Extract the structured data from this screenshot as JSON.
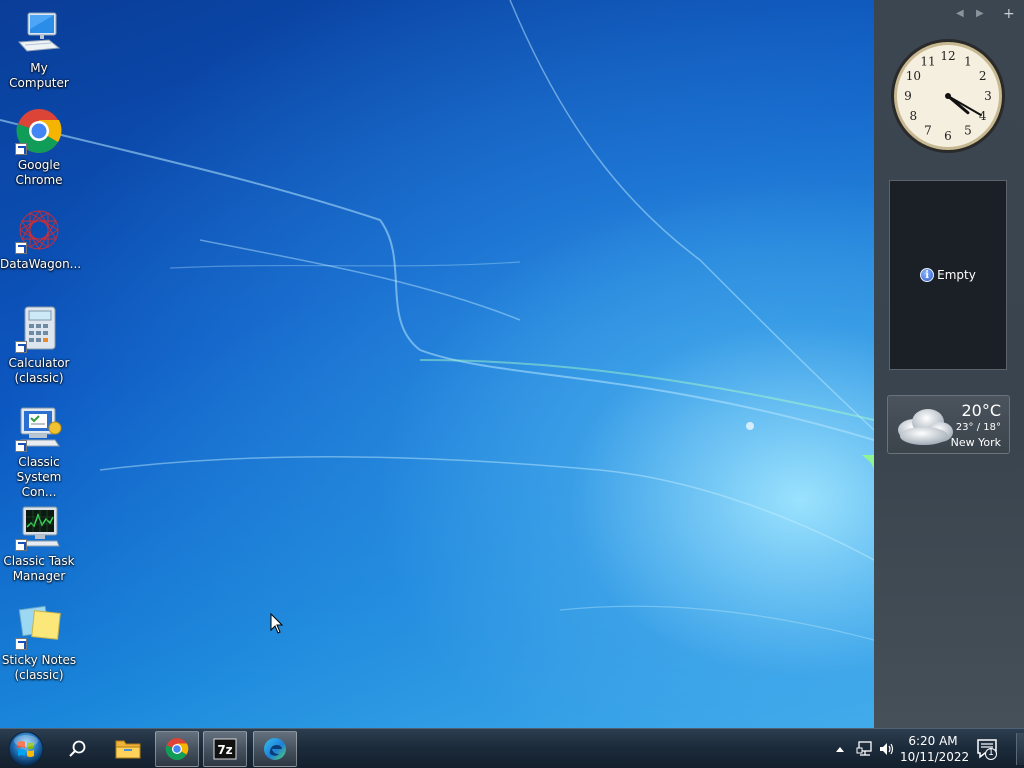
{
  "desktop": {
    "icons": [
      {
        "label": "My Computer",
        "icon": "computer-icon"
      },
      {
        "label": "Google Chrome",
        "icon": "chrome-icon"
      },
      {
        "label": "DataWagon...",
        "icon": "datawagon-icon"
      },
      {
        "label": "Calculator (classic)",
        "icon": "calculator-icon"
      },
      {
        "label": "Classic System Con...",
        "icon": "control-panel-icon"
      },
      {
        "label": "Classic Task Manager",
        "icon": "task-manager-icon"
      },
      {
        "label": "Sticky Notes (classic)",
        "icon": "sticky-notes-icon"
      }
    ]
  },
  "sidebar": {
    "controls": {
      "prev": "◀",
      "next": "▶",
      "add": "+"
    },
    "clock": {
      "hour": 4,
      "minute": 20,
      "numerals": [
        "12",
        "1",
        "2",
        "3",
        "4",
        "5",
        "6",
        "7",
        "8",
        "9",
        "10",
        "11"
      ]
    },
    "slideshow": {
      "status": "Empty"
    },
    "weather": {
      "temp": "20°C",
      "range": "23° / 18°",
      "city": "New York",
      "condition_icon": "cloudy-icon"
    }
  },
  "taskbar": {
    "buttons": [
      "start-button",
      "search-icon",
      "file-explorer-icon",
      "chrome-icon",
      "7zip-icon",
      "edge-icon"
    ],
    "tray": {
      "time": "6:20 AM",
      "date": "10/11/2022",
      "notification_count": "1"
    }
  },
  "colors": {
    "taskbar": "#1b2a3a",
    "sidebar": "#3c4650",
    "desktop_blue": "#0c58c2"
  }
}
